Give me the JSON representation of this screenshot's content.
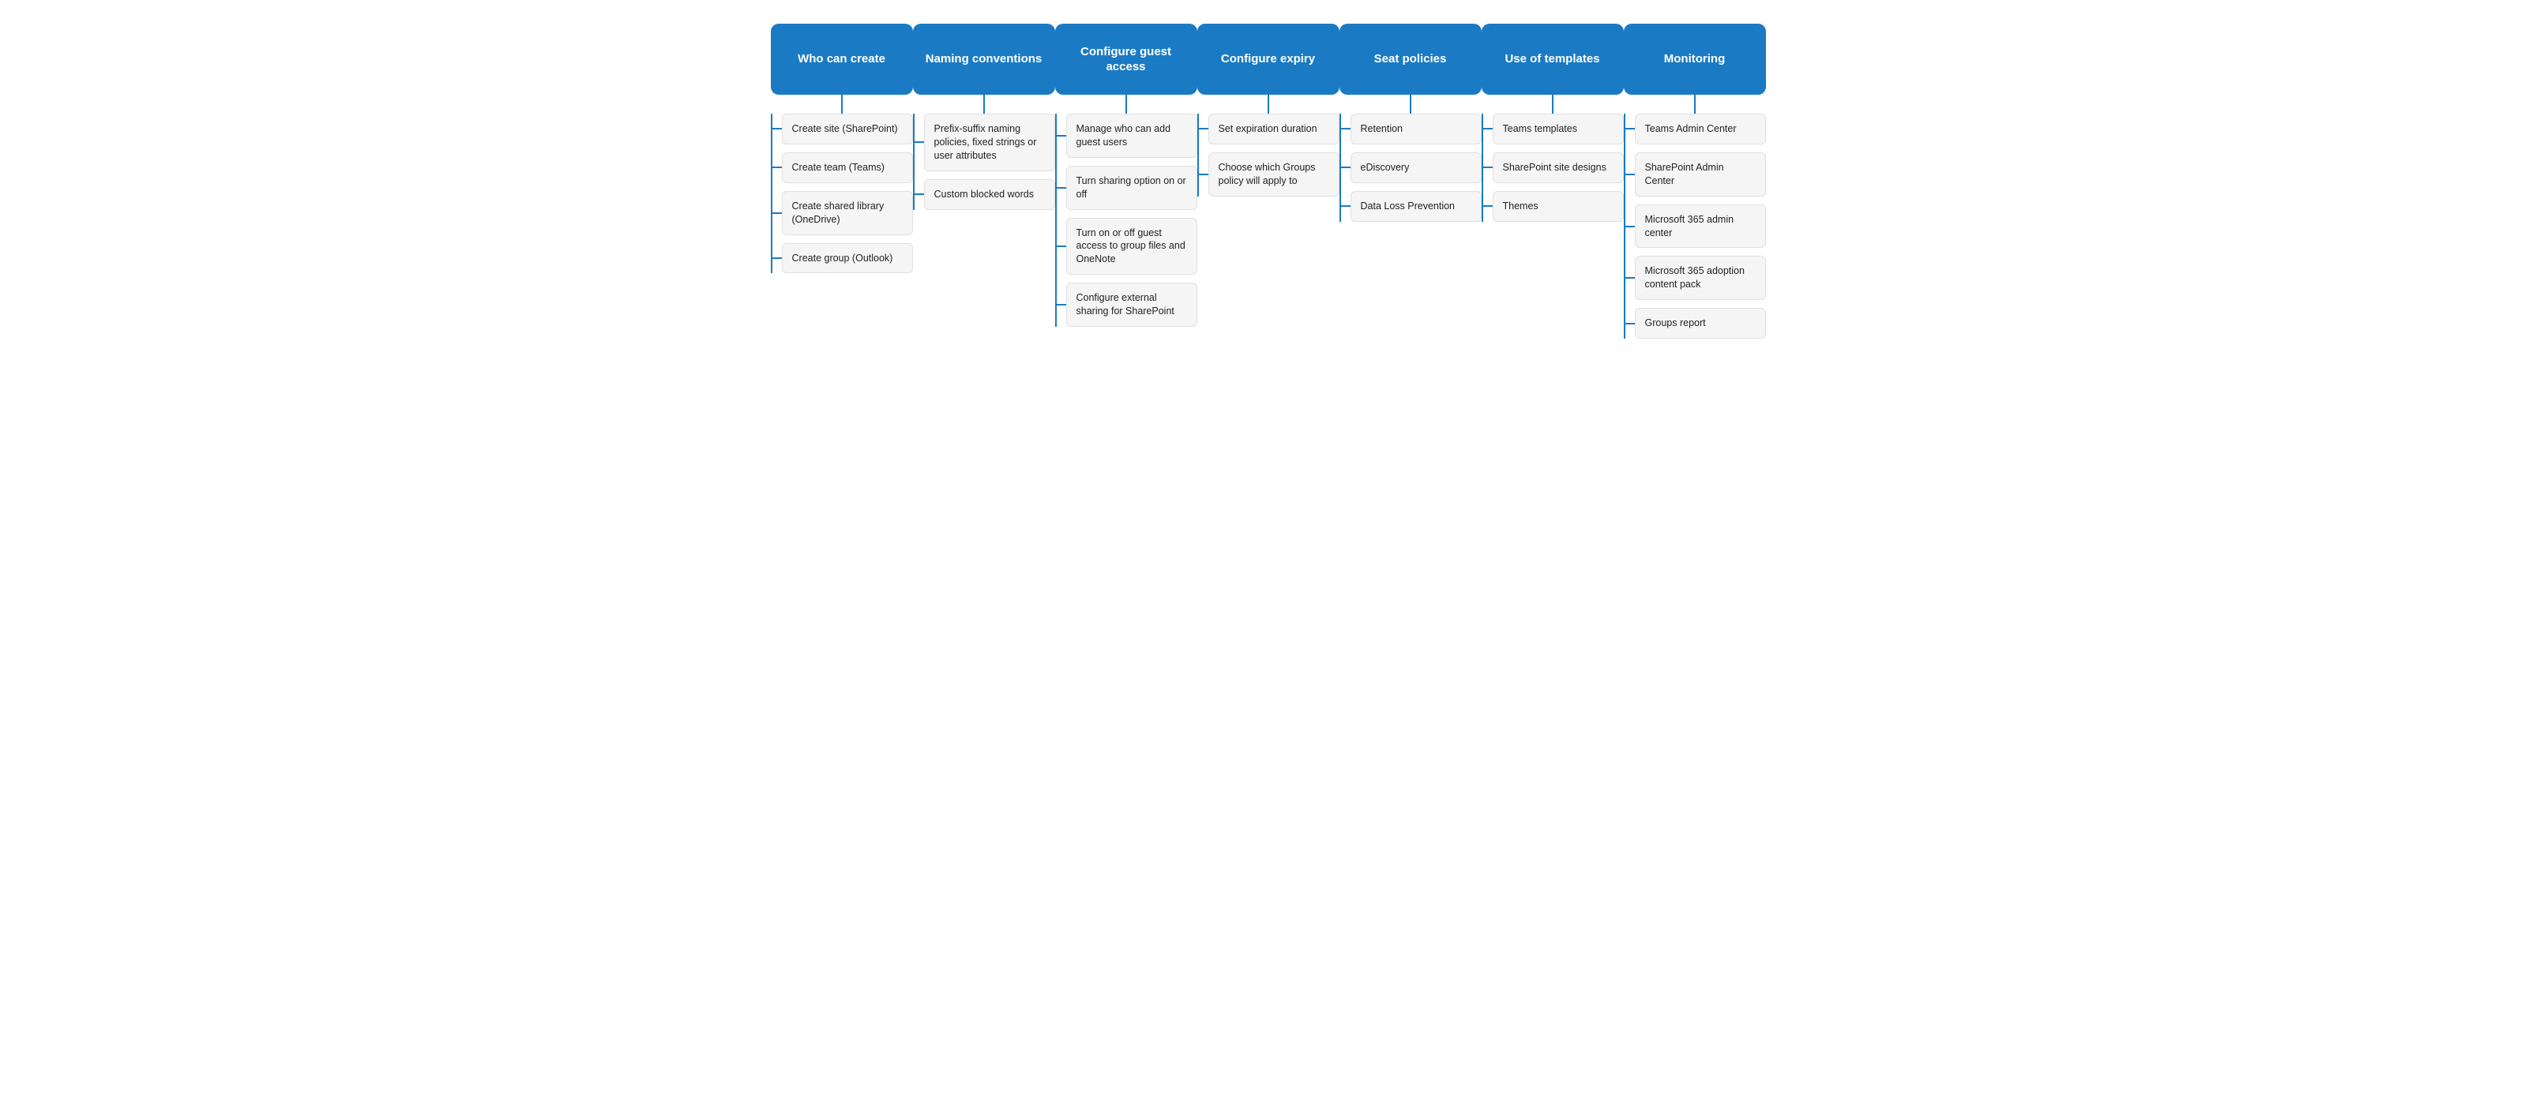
{
  "columns": [
    {
      "id": "who-can-create",
      "header": "Who can create",
      "items": [
        "Create site (SharePoint)",
        "Create team (Teams)",
        "Create shared library (OneDrive)",
        "Create group (Outlook)"
      ]
    },
    {
      "id": "naming-conventions",
      "header": "Naming conventions",
      "items": [
        "Prefix-suffix naming policies, fixed strings or user attributes",
        "Custom blocked words"
      ]
    },
    {
      "id": "configure-guest-access",
      "header": "Configure guest access",
      "items": [
        "Manage who can add guest users",
        "Turn sharing option on or off",
        "Turn on or off guest access to group files and OneNote",
        "Configure external sharing for SharePoint"
      ]
    },
    {
      "id": "configure-expiry",
      "header": "Configure expiry",
      "items": [
        "Set expiration duration",
        "Choose which Groups policy will apply to"
      ]
    },
    {
      "id": "seat-policies",
      "header": "Seat policies",
      "items": [
        "Retention",
        "eDiscovery",
        "Data Loss Prevention"
      ]
    },
    {
      "id": "use-of-templates",
      "header": "Use of templates",
      "items": [
        "Teams templates",
        "SharePoint site designs",
        "Themes"
      ]
    },
    {
      "id": "monitoring",
      "header": "Monitoring",
      "items": [
        "Teams Admin Center",
        "SharePoint Admin Center",
        "Microsoft 365 admin center",
        "Microsoft 365 adoption content pack",
        "Groups report"
      ]
    }
  ]
}
